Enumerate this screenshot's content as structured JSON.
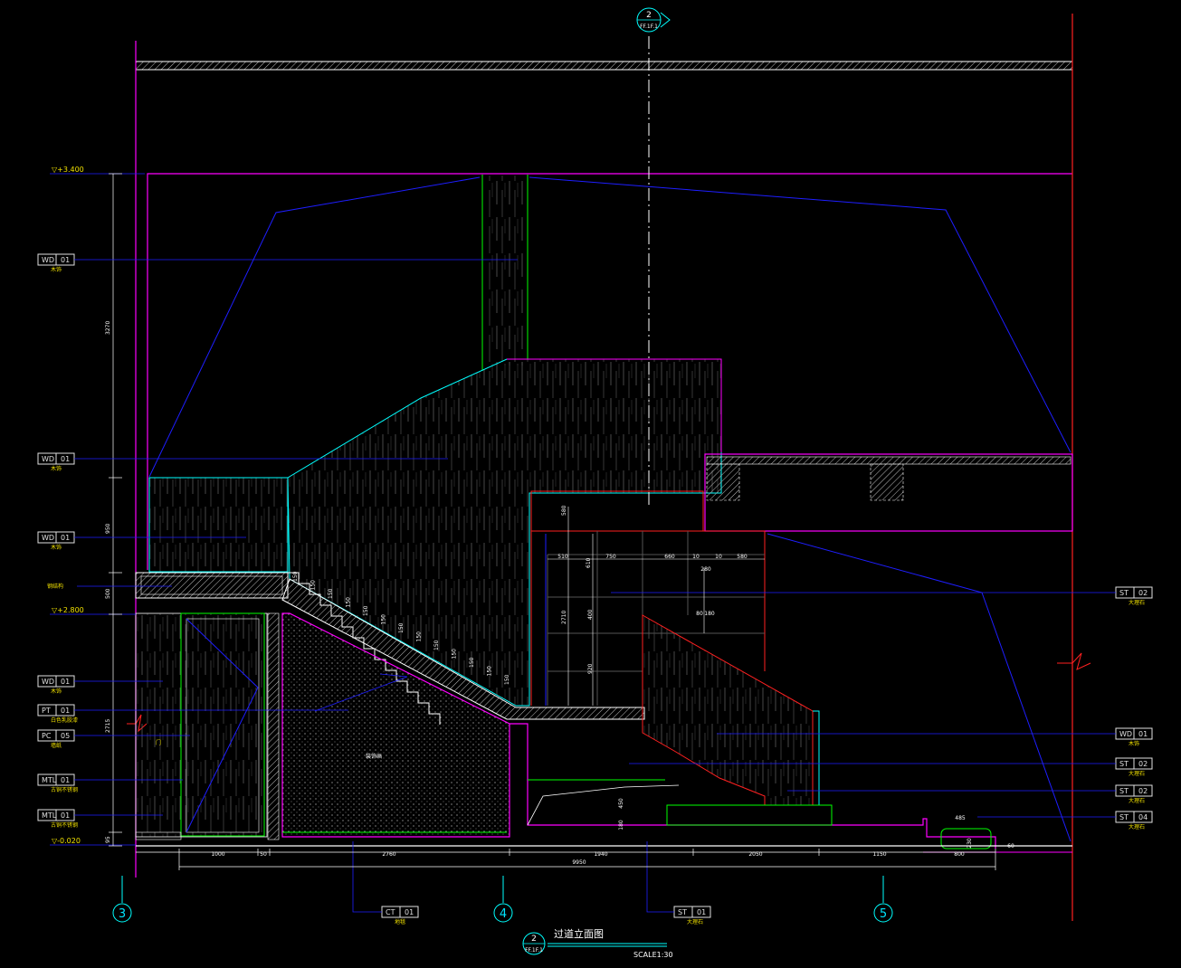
{
  "drawing": {
    "top_marker": {
      "num": "2",
      "ref": "FF.1F.1"
    },
    "title": {
      "marker_num": "2",
      "marker_ref": "FF.1F.1",
      "name": "过道立面图",
      "scale": "SCALE1:30"
    },
    "grid_axes": [
      "3",
      "4",
      "5"
    ],
    "levels": [
      "▽+3.400",
      "▽+2.800",
      "▽-0.020"
    ],
    "left_tags": [
      {
        "code": "WD",
        "num": "01",
        "desc": "木饰"
      },
      {
        "code": "WD",
        "num": "01",
        "desc": "木饰"
      },
      {
        "code": "WD",
        "num": "01",
        "desc": "木饰"
      },
      {
        "code": "WD",
        "num": "01",
        "desc": "木饰"
      },
      {
        "code": "PT",
        "num": "01",
        "desc": "白色乳胶漆"
      },
      {
        "code": "PC",
        "num": "05",
        "desc": "墙纸"
      },
      {
        "code": "MTL",
        "num": "01",
        "desc": "古铜不锈钢"
      },
      {
        "code": "MTL",
        "num": "01",
        "desc": "古铜不锈钢"
      }
    ],
    "left_note": "钢结构",
    "door_note": "门",
    "wall_note": "装饰画",
    "right_tags": [
      {
        "code": "ST",
        "num": "02",
        "desc": "大理石"
      },
      {
        "code": "WD",
        "num": "01",
        "desc": "木饰"
      },
      {
        "code": "ST",
        "num": "02",
        "desc": "大理石"
      },
      {
        "code": "ST",
        "num": "02",
        "desc": "大理石"
      },
      {
        "code": "ST",
        "num": "04",
        "desc": "大理石"
      }
    ],
    "bottom_tags": [
      {
        "code": "CT",
        "num": "01",
        "desc": "地毯"
      },
      {
        "code": "ST",
        "num": "01",
        "desc": "大理石"
      }
    ],
    "bottom_dims": [
      "1000",
      "50",
      "2760",
      "1940",
      "2050",
      "1150"
    ],
    "total_dim": "9950",
    "left_vdims": [
      "3270",
      "950",
      "500",
      "2715",
      "95"
    ],
    "stair_dims": [
      "150",
      "150",
      "150",
      "150",
      "150",
      "150",
      "150",
      "150",
      "150",
      "150",
      "150",
      "150",
      "150",
      "150",
      "150"
    ],
    "wall_hdims": [
      "510",
      "750",
      "660",
      "10",
      "10",
      "580",
      "280"
    ],
    "wall_vdims": [
      "580",
      "610",
      "2710",
      "400",
      "920"
    ],
    "misc_dims": [
      "80",
      "180",
      "450",
      "180",
      "485",
      "230",
      "60",
      "800"
    ],
    "colors": {
      "magenta": "#ff00ff",
      "blue": "#1e1eff",
      "cyan": "#00ffff",
      "red": "#ff2020",
      "green": "#00ff00",
      "white": "#ffffff",
      "yellow": "#f0e000"
    }
  }
}
